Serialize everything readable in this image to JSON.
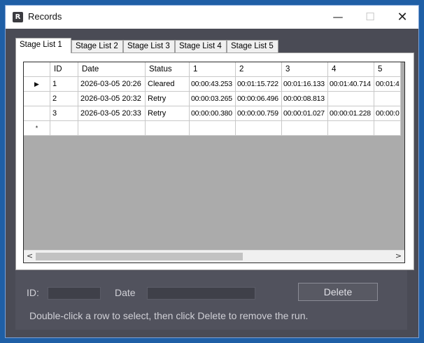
{
  "window": {
    "title": "Records",
    "icon": "app-icon",
    "controls": {
      "minimize": "—",
      "maximize": "☐",
      "close": "✕"
    }
  },
  "tabs": [
    "Stage List 1",
    "Stage List 2",
    "Stage List 3",
    "Stage List 4",
    "Stage List 5"
  ],
  "active_tab": "Stage List 1",
  "grid": {
    "columns": [
      "ID",
      "Date",
      "Status",
      "1",
      "2",
      "3",
      "4",
      "5"
    ],
    "rows": [
      {
        "marker": "▶",
        "cells": [
          "1",
          "2026-03-05 20:26",
          "Cleared",
          "00:00:43.253",
          "00:01:15.722",
          "00:01:16.133",
          "00:01:40.714",
          "00:01:4"
        ]
      },
      {
        "marker": "",
        "cells": [
          "2",
          "2026-03-05 20:32",
          "Retry",
          "00:00:03.265",
          "00:00:06.496",
          "00:00:08.813",
          "",
          ""
        ]
      },
      {
        "marker": "",
        "cells": [
          "3",
          "2026-03-05 20:33",
          "Retry",
          "00:00:00.380",
          "00:00:00.759",
          "00:00:01.027",
          "00:00:01.228",
          "00:00:0"
        ]
      },
      {
        "marker": "*",
        "cells": [
          "",
          "",
          "",
          "",
          "",
          "",
          "",
          ""
        ]
      }
    ],
    "scroll_left_glyph": "<",
    "scroll_right_glyph": ">"
  },
  "form": {
    "id_label": "ID:",
    "id_value": "",
    "date_label": "Date",
    "date_value": "",
    "delete_label": "Delete",
    "hint": "Double-click a row to select, then click Delete to remove the run."
  }
}
